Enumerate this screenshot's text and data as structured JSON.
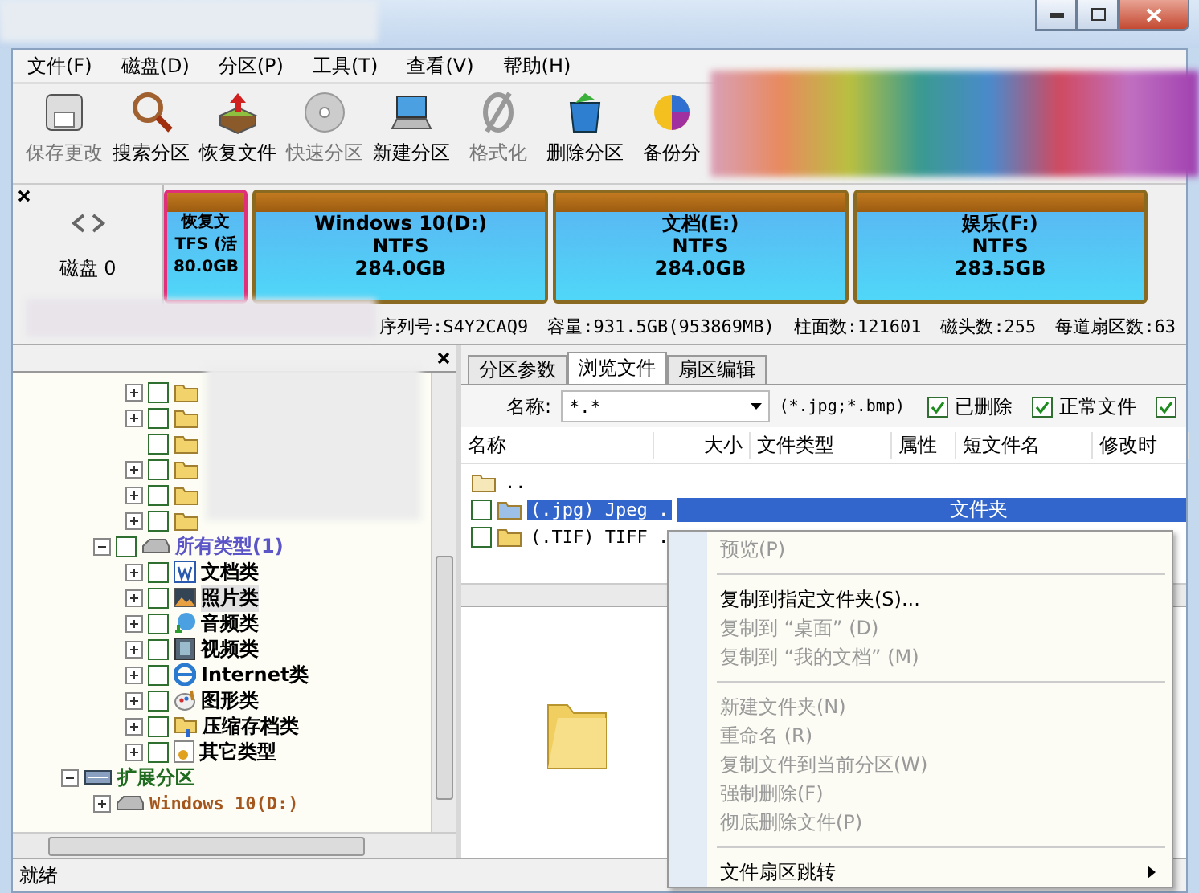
{
  "menu": [
    "文件(F)",
    "磁盘(D)",
    "分区(P)",
    "工具(T)",
    "查看(V)",
    "帮助(H)"
  ],
  "toolbar": [
    {
      "kind": "save",
      "label": "保存更改",
      "disabled": true
    },
    {
      "kind": "search",
      "label": "搜索分区",
      "disabled": false
    },
    {
      "kind": "recover",
      "label": "恢复文件",
      "disabled": false
    },
    {
      "kind": "quick",
      "label": "快速分区",
      "disabled": true
    },
    {
      "kind": "new",
      "label": "新建分区",
      "disabled": false
    },
    {
      "kind": "format",
      "label": "格式化",
      "disabled": true
    },
    {
      "kind": "delete",
      "label": "删除分区",
      "disabled": false
    },
    {
      "kind": "backup",
      "label": "备份分",
      "disabled": false
    }
  ],
  "disk_map": {
    "disk_label": "磁盘 0",
    "partitions": [
      {
        "lines": [
          "恢复文",
          "TFS (活",
          "80.0GB"
        ],
        "selected": true
      },
      {
        "lines": [
          "Windows 10(D:)",
          "NTFS",
          "284.0GB"
        ],
        "selected": false
      },
      {
        "lines": [
          "文档(E:)",
          "NTFS",
          "284.0GB"
        ],
        "selected": false
      },
      {
        "lines": [
          "娱乐(F:)",
          "NTFS",
          "283.5GB"
        ],
        "selected": false
      }
    ]
  },
  "disk_info": [
    "序列号:S4Y2CAQ9",
    "容量:931.5GB(953869MB)",
    "柱面数:121601",
    "磁头数:255",
    "每道扇区数:63"
  ],
  "tree": [
    {
      "kind": "hidden",
      "children": [
        {
          "kind": "hidden",
          "children": [
            {
              "kind": "folder",
              "expanded": false,
              "checked": false
            },
            {
              "kind": "folder",
              "expanded": false,
              "checked": false
            },
            {
              "kind": "folder",
              "checked": false
            },
            {
              "kind": "folder",
              "expanded": false,
              "checked": false
            },
            {
              "kind": "folder",
              "expanded": false,
              "checked": false
            },
            {
              "kind": "folder",
              "expanded": false,
              "checked": false
            }
          ]
        },
        {
          "kind": "all-types",
          "label": "所有类型(1)",
          "color": "#5b55c8",
          "expanded": true,
          "checked": false,
          "children": [
            {
              "kind": "document",
              "label": "文档类",
              "expanded": false,
              "checked": false,
              "selected": false
            },
            {
              "kind": "photo",
              "label": "照片类",
              "expanded": false,
              "checked": false,
              "selected": true
            },
            {
              "kind": "audio",
              "label": "音频类",
              "expanded": false,
              "checked": false,
              "selected": false
            },
            {
              "kind": "video",
              "label": "视频类",
              "expanded": false,
              "checked": false,
              "selected": false
            },
            {
              "kind": "internet",
              "label": "Internet类",
              "expanded": false,
              "checked": false,
              "selected": false
            },
            {
              "kind": "graphics",
              "label": "图形类",
              "expanded": false,
              "checked": false,
              "selected": false
            },
            {
              "kind": "archive",
              "label": "压缩存档类",
              "expanded": false,
              "checked": false,
              "selected": false
            },
            {
              "kind": "other",
              "label": "其它类型",
              "expanded": false,
              "checked": false,
              "selected": false
            }
          ]
        }
      ]
    },
    {
      "kind": "extended",
      "label": "扩展分区",
      "color": "#1f6b1f",
      "expanded": true,
      "children": [
        {
          "kind": "partition",
          "label": "Windows 10(D:)",
          "color": "#a4561c",
          "expanded": false
        }
      ]
    }
  ],
  "tabs": [
    {
      "label": "分区参数",
      "selected": false
    },
    {
      "label": "浏览文件",
      "selected": true
    },
    {
      "label": "扇区编辑",
      "selected": false
    }
  ],
  "filter": {
    "label": "名称:",
    "value": "*.*",
    "hint": "(*.jpg;*.bmp)",
    "options": [
      {
        "label": "已删除",
        "checked": true
      },
      {
        "label": "正常文件",
        "checked": true
      },
      {
        "checked": true
      }
    ]
  },
  "file_table": {
    "columns": [
      "名称",
      "大小",
      "文件类型",
      "属性",
      "短文件名",
      "修改时"
    ],
    "rows": [
      {
        "kind": "parent",
        "name": "..",
        "selected": false
      },
      {
        "kind": "folder",
        "name": "(.jpg) Jpeg .",
        "type": "文件夹",
        "checked": false,
        "selected": true
      },
      {
        "kind": "folder",
        "name": "(.TIF) TIFF .",
        "checked": false,
        "selected": false
      }
    ]
  },
  "context_menu": [
    {
      "kind": "item",
      "label": "预览(P)",
      "disabled": true
    },
    {
      "kind": "separator"
    },
    {
      "kind": "item",
      "label": "复制到指定文件夹(S)...",
      "disabled": false
    },
    {
      "kind": "item",
      "label": "复制到 “桌面” (D)",
      "disabled": true
    },
    {
      "kind": "item",
      "label": "复制到 “我的文档” (M)",
      "disabled": true
    },
    {
      "kind": "separator"
    },
    {
      "kind": "item",
      "label": "新建文件夹(N)",
      "disabled": true
    },
    {
      "kind": "item",
      "label": "重命名 (R)",
      "disabled": true
    },
    {
      "kind": "item",
      "label": "复制文件到当前分区(W)",
      "disabled": true
    },
    {
      "kind": "item",
      "label": "强制删除(F)",
      "disabled": true
    },
    {
      "kind": "item",
      "label": "彻底删除文件(P)",
      "disabled": true
    },
    {
      "kind": "separator"
    },
    {
      "kind": "submenu",
      "label": "文件扇区跳转",
      "disabled": false
    }
  ],
  "status_bar": "就绪"
}
